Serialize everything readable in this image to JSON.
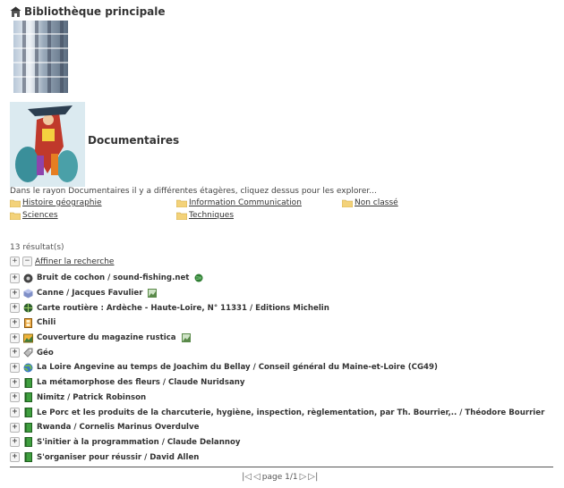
{
  "library": {
    "title": "Bibliothèque principale"
  },
  "shelf": {
    "title": "Documentaires",
    "description": "Dans le rayon Documentaires il y a différentes étagères, cliquez dessus pour les explorer..."
  },
  "categories": [
    {
      "label": "Histoire géographie"
    },
    {
      "label": "Information Communication"
    },
    {
      "label": "Non classé"
    },
    {
      "label": "Sciences"
    },
    {
      "label": "Techniques"
    }
  ],
  "results": {
    "count_label": "13 résultat(s)",
    "refine_label": "Affiner la recherche",
    "items": [
      {
        "title": "Bruit de cochon / sound-fishing.net",
        "icon": "audio-icon",
        "tail_icon": "web-icon"
      },
      {
        "title": "Canne / Jacques Favulier",
        "icon": "object-icon",
        "tail_icon": "image-icon"
      },
      {
        "title": "Carte routière : Ardèche - Haute-Loire, N° 11331 / Editions Michelin",
        "icon": "map-icon"
      },
      {
        "title": "Chili",
        "icon": "film-icon"
      },
      {
        "title": "Couverture du magazine rustica",
        "icon": "picture-icon",
        "tail_icon": "image-icon"
      },
      {
        "title": "Géo",
        "icon": "periodical-icon"
      },
      {
        "title": "La Loire Angevine au temps de Joachim du Bellay / Conseil général du Maine-et-Loire (CG49)",
        "icon": "globe-icon"
      },
      {
        "title": "La métamorphose des fleurs / Claude Nuridsany",
        "icon": "book-icon"
      },
      {
        "title": "Nimitz / Patrick Robinson",
        "icon": "book-icon"
      },
      {
        "title": "Le Porc et les produits de la charcuterie, hygiène, inspection, règlementation, par Th. Bourrier,.. / Théodore Bourrier",
        "icon": "book-icon"
      },
      {
        "title": "Rwanda / Cornelis Marinus Overdulve",
        "icon": "book-icon"
      },
      {
        "title": "S'initier à la programmation / Claude Delannoy",
        "icon": "book-icon"
      },
      {
        "title": "S'organiser pour réussir / David Allen",
        "icon": "book-icon"
      }
    ]
  },
  "pagination": {
    "label": "page 1/1"
  }
}
